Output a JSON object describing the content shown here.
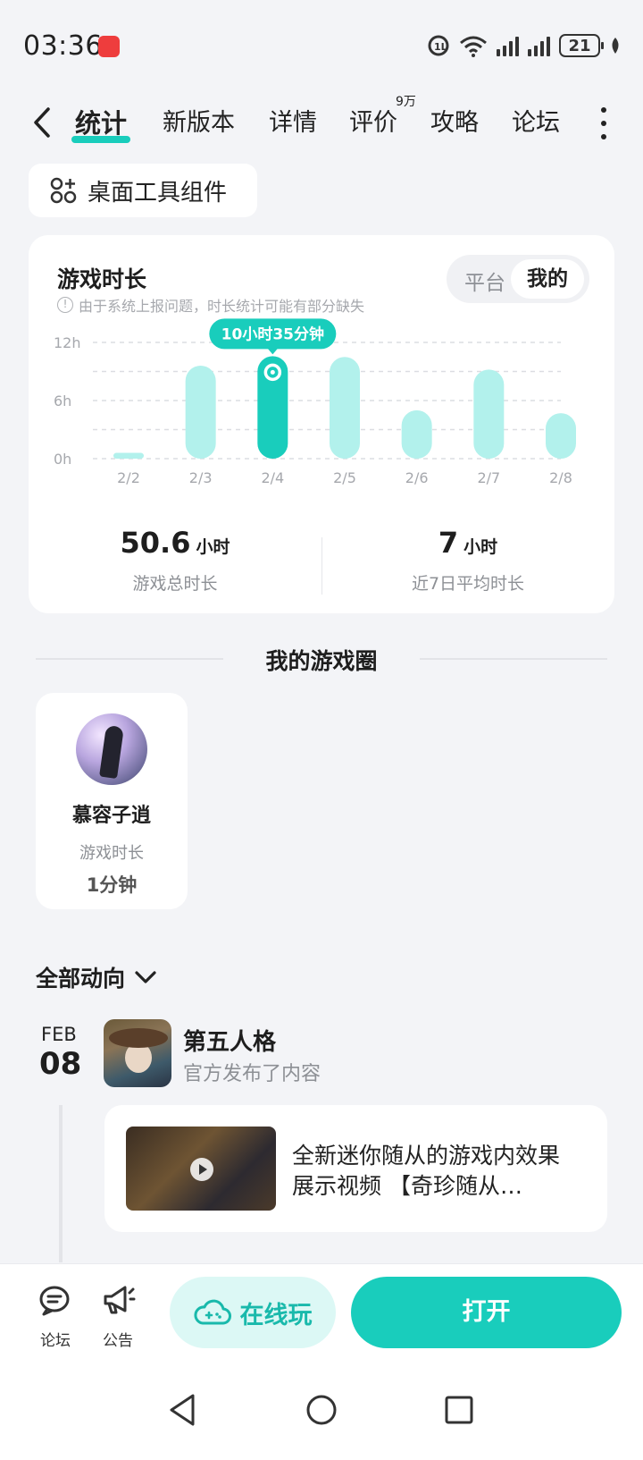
{
  "status": {
    "time": "03:36",
    "battery": "21"
  },
  "tabs": [
    {
      "label": "统计"
    },
    {
      "label": "新版本"
    },
    {
      "label": "详情"
    },
    {
      "label": "评价"
    },
    {
      "label": "攻略"
    },
    {
      "label": "论坛"
    }
  ],
  "review_badge": "9万",
  "widget_button": "桌面工具组件",
  "playtime": {
    "title": "游戏时长",
    "note": "由于系统上报问题，时长统计可能有部分缺失",
    "toggle": {
      "option_a": "平台",
      "option_b": "我的",
      "selected": "我的"
    },
    "total_value": "50.6",
    "total_unit": "小时",
    "total_label": "游戏总时长",
    "avg_value": "7",
    "avg_unit": "小时",
    "avg_label": "近7日平均时长"
  },
  "chart_data": {
    "type": "bar",
    "categories": [
      "2/2",
      "2/3",
      "2/4",
      "2/5",
      "2/6",
      "2/7",
      "2/8"
    ],
    "values": [
      0.6,
      9.6,
      10.58,
      10.5,
      5.0,
      9.2,
      4.7
    ],
    "y_ticks": [
      "0h",
      "6h",
      "12h"
    ],
    "ylim": [
      0,
      12
    ],
    "highlight_index": 2,
    "highlight_label": "10小时35分钟",
    "colors": {
      "bar": "#b2f1ec",
      "highlight": "#19cdbc"
    }
  },
  "circle": {
    "title": "我的游戏圈",
    "friend_name": "慕容子逍",
    "friend_label": "游戏时长",
    "friend_time": "1分钟"
  },
  "activity": {
    "filter_label": "全部动向",
    "month": "FEB",
    "day": "08",
    "game_name": "第五人格",
    "game_sub": "官方发布了内容",
    "post_text": "全新迷你随从的游戏内效果展示视频 【奇珍随从…"
  },
  "bottom": {
    "forum_label": "论坛",
    "notice_label": "公告",
    "online_label": "在线玩",
    "open_label": "打开"
  },
  "colors": {
    "accent": "#19cdbc",
    "background": "#f3f4f7"
  }
}
